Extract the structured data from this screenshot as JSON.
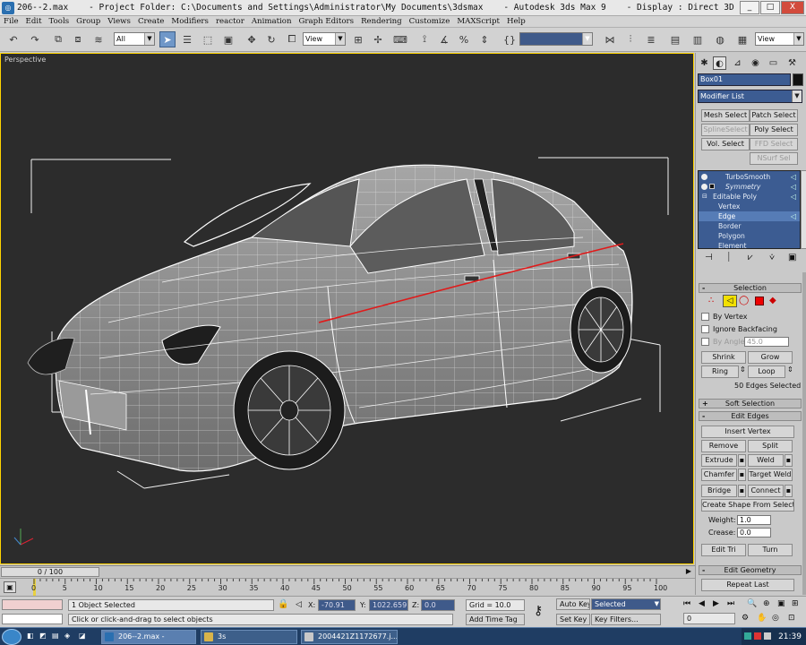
{
  "titlebar": {
    "title": "206--2.max    - Project Folder: C:\\Documents and Settings\\Administrator\\My Documents\\3dsmax    - Autodesk 3ds Max 9    - Display : Direct 3D",
    "minimize": "_",
    "maximize": "□",
    "close": "X"
  },
  "menu": [
    "File",
    "Edit",
    "Tools",
    "Group",
    "Views",
    "Create",
    "Modifiers",
    "reactor",
    "Animation",
    "Graph Editors",
    "Rendering",
    "Customize",
    "MAXScript",
    "Help"
  ],
  "toolbar": {
    "filter_value": "All",
    "coord_value": "View",
    "named_sel_value": "",
    "view_value": "View"
  },
  "viewport": {
    "label": "Perspective"
  },
  "command_panel": {
    "object_name": "Box01",
    "modifier_list": "Modifier List",
    "sel_buttons": [
      {
        "label": "Mesh Select",
        "enabled": true
      },
      {
        "label": "Patch Select",
        "enabled": true
      },
      {
        "label": "SplineSelect",
        "enabled": false
      },
      {
        "label": "Poly Select",
        "enabled": true
      },
      {
        "label": "Vol. Select",
        "enabled": true
      },
      {
        "label": "FFD Select",
        "enabled": false
      },
      {
        "label": "NSurf Sel",
        "enabled": false
      }
    ],
    "stack": [
      {
        "label": "TurboSmooth",
        "level": 0
      },
      {
        "label": "Symmetry",
        "level": 0
      },
      {
        "label": "Editable Poly",
        "level": 0
      },
      {
        "label": "Vertex",
        "level": 1
      },
      {
        "label": "Edge",
        "level": 1
      },
      {
        "label": "Border",
        "level": 1
      },
      {
        "label": "Polygon",
        "level": 1
      },
      {
        "label": "Element",
        "level": 1
      }
    ],
    "selection": {
      "title": "Selection",
      "by_vertex": "By Vertex",
      "ignore_backfacing": "Ignore Backfacing",
      "by_angle": "By Angle:",
      "angle_value": "45.0",
      "shrink": "Shrink",
      "grow": "Grow",
      "ring": "Ring",
      "loop": "Loop",
      "status": "50 Edges Selected"
    },
    "soft_selection": "Soft Selection",
    "edit_edges": {
      "title": "Edit Edges",
      "insert_vertex": "Insert Vertex",
      "remove": "Remove",
      "split": "Split",
      "extrude": "Extrude",
      "weld": "Weld",
      "chamfer": "Chamfer",
      "target_weld": "Target Weld",
      "bridge": "Bridge",
      "connect": "Connect",
      "create_shape": "Create Shape From Selection",
      "weight_label": "Weight:",
      "weight_value": "1.0",
      "crease_label": "Crease:",
      "crease_value": "0.0",
      "edit_tri": "Edit Tri",
      "turn": "Turn"
    },
    "edit_geometry": {
      "title": "Edit Geometry",
      "repeat_last": "Repeat Last"
    }
  },
  "timeslider": {
    "frame_display": "0 / 100"
  },
  "trackbar": {
    "ticks": [
      "0",
      "5",
      "10",
      "15",
      "20",
      "25",
      "30",
      "35",
      "40",
      "45",
      "50",
      "55",
      "60",
      "65",
      "70",
      "75",
      "80",
      "85",
      "90",
      "95",
      "100"
    ]
  },
  "status": {
    "objects_selected": "1 Object Selected",
    "prompt": "Click or click-and-drag to select objects",
    "x_label": "X:",
    "x_value": "-70.91",
    "y_label": "Y:",
    "y_value": "1022.659",
    "z_label": "Z:",
    "z_value": "0.0",
    "grid": "Grid = 10.0",
    "add_time_tag": "Add Time Tag",
    "auto_key": "Auto Key",
    "set_key": "Set Key",
    "selected_value": "Selected",
    "key_filters": "Key Filters...",
    "frame_value": "0"
  },
  "taskbar": {
    "items": [
      {
        "label": "206--2.max     -",
        "active": true
      },
      {
        "label": "3s",
        "active": false
      },
      {
        "label": "2004421Z1172677.j...",
        "active": false
      }
    ],
    "clock": "21:39"
  },
  "colors": {
    "viewport_bg": "#2c2c2c",
    "active_border": "#ffd400",
    "selected_edges": "#e01a1a",
    "wire": "#ffffff"
  }
}
